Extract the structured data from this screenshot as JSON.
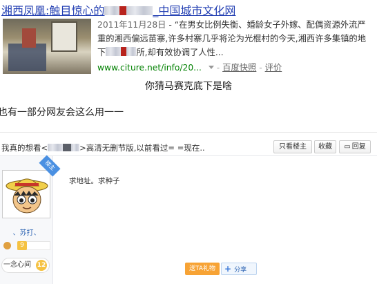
{
  "result": {
    "title_prefix": "湘西凤凰:触目惊心的",
    "title_suffix": "_中国城市文化网",
    "date": "2011年11月28日",
    "snippet_1": " - “在男女比例失衡、婚龄女子外嫁、配偶资源外流严重的湘西偏远苗寨,许多村寨几乎将沦为光棍村的今天,湘西许多集镇的地下",
    "snippet_2": "所,却有效协调了人性...",
    "url": "www.citure.net/info/20...",
    "snapshot": "百度快照",
    "separator": "-",
    "review": "评价",
    "thumbnail_icon": "photo-thumbnail-icon"
  },
  "captions": {
    "line_1": "你猜马赛克底下是啥",
    "line_2": "也有一部分网友会这么用一一"
  },
  "post": {
    "title_prefix": "我真的想看<",
    "title_suffix": ">高清无删节版,以前看过= =现在..",
    "buttons": {
      "only_op": "只看楼主",
      "favorite": "收藏",
      "reply": "回复"
    },
    "lz_badge": "楼主",
    "username": "、苏打、",
    "level": "9",
    "user_title": "一念心间",
    "user_title_level": "12",
    "body": "求地址。求种子",
    "gift_label": "送TA礼物",
    "share_label": "分享"
  },
  "colors": {
    "link_blue": "#2440b3",
    "url_green": "#008000",
    "badge_blue": "#4a90e2",
    "gift_orange": "#f7a335"
  }
}
